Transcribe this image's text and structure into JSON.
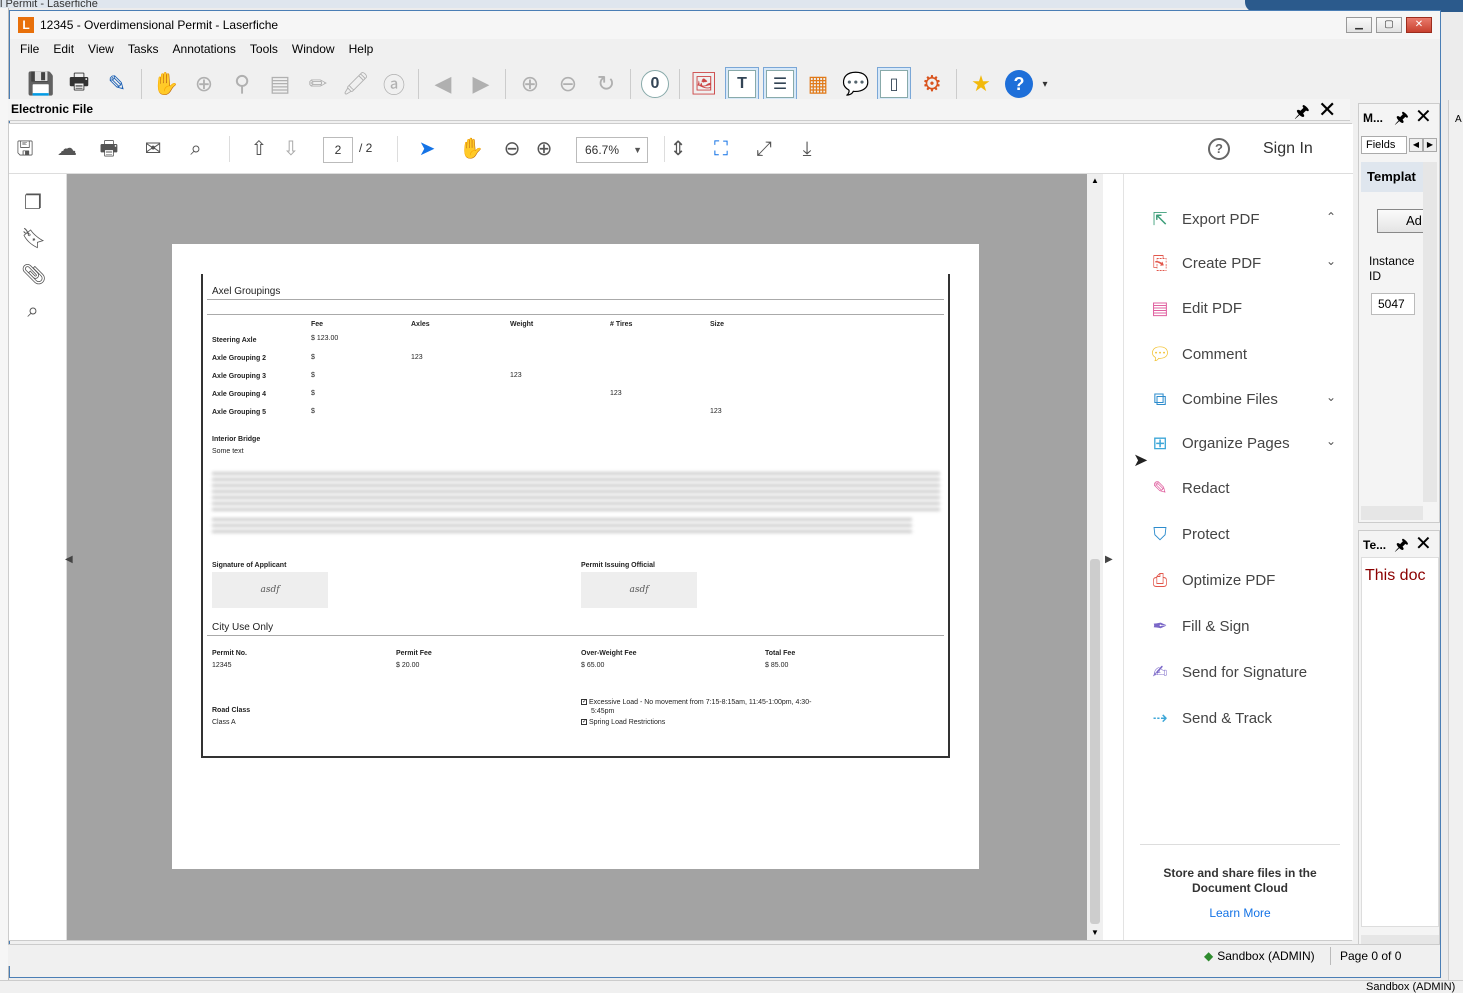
{
  "bg": {
    "title_fragment": "l Permit - Laserfiche",
    "right_fragment": "A",
    "bottom_fragment": "Sandbox (ADMIN)"
  },
  "window": {
    "app_logo": "L",
    "title": "12345 - Overdimensional Permit - Laserfiche",
    "min": "▁",
    "max": "▢",
    "close": "✕"
  },
  "menu": [
    "File",
    "Edit",
    "View",
    "Tasks",
    "Annotations",
    "Tools",
    "Window",
    "Help"
  ],
  "pane": {
    "title": "Electronic File",
    "pin": "🖈",
    "close": "✕"
  },
  "acrobat": {
    "page_current": "2",
    "page_total": "/ 2",
    "zoom": "66.7%",
    "help": "?",
    "sign_in": "Sign In"
  },
  "document": {
    "section1": "Axel Groupings",
    "columns": [
      "Fee",
      "Axles",
      "Weight",
      "# Tires",
      "Size"
    ],
    "rows": [
      {
        "label": "Steering Axle",
        "fee": "$ 123.00",
        "axles": "",
        "weight": "",
        "tires": "",
        "size": ""
      },
      {
        "label": "Axle Grouping 2",
        "fee": "$",
        "axles": "123",
        "weight": "",
        "tires": "",
        "size": ""
      },
      {
        "label": "Axle Grouping 3",
        "fee": "$",
        "axles": "",
        "weight": "123",
        "tires": "",
        "size": ""
      },
      {
        "label": "Axle Grouping 4",
        "fee": "$",
        "axles": "",
        "weight": "",
        "tires": "123",
        "size": ""
      },
      {
        "label": "Axle Grouping 5",
        "fee": "$",
        "axles": "",
        "weight": "",
        "tires": "",
        "size": "123"
      }
    ],
    "interior_bridge_label": "Interior Bridge",
    "interior_bridge_value": "Some text",
    "sig_applicant_label": "Signature of Applicant",
    "sig_applicant_value": "asdf",
    "sig_official_label": "Permit Issuing Official",
    "sig_official_value": "asdf",
    "section2": "City Use Only",
    "permit_no_label": "Permit No.",
    "permit_no_value": "12345",
    "permit_fee_label": "Permit Fee",
    "permit_fee_value": "$ 20.00",
    "overweight_fee_label": "Over-Weight Fee",
    "overweight_fee_value": "$ 65.00",
    "total_fee_label": "Total Fee",
    "total_fee_value": "$ 85.00",
    "road_class_label": "Road Class",
    "road_class_value": "Class A",
    "check1_line1": "Excessive Load - No movement from 7:15-8:15am, 11:45-1:00pm, 4:30-",
    "check1_line2": "5:45pm",
    "check2": "Spring Load Restrictions",
    "check_mark": "✓"
  },
  "tools": [
    {
      "label": "Export PDF",
      "chev": "⌃",
      "color": "#3d9e7a"
    },
    {
      "label": "Create PDF",
      "chev": "⌄",
      "color": "#e2574c"
    },
    {
      "label": "Edit PDF",
      "chev": "",
      "color": "#e061a0"
    },
    {
      "label": "Comment",
      "chev": "",
      "color": "#f2c12e"
    },
    {
      "label": "Combine Files",
      "chev": "⌄",
      "color": "#2d8ccd"
    },
    {
      "label": "Organize Pages",
      "chev": "⌄",
      "color": "#3ea7d8"
    },
    {
      "label": "Redact",
      "chev": "",
      "color": "#e061a0"
    },
    {
      "label": "Protect",
      "chev": "",
      "color": "#2d8ccd"
    },
    {
      "label": "Optimize PDF",
      "chev": "",
      "color": "#e2574c"
    },
    {
      "label": "Fill & Sign",
      "chev": "",
      "color": "#7b68c8"
    },
    {
      "label": "Send for Signature",
      "chev": "",
      "color": "#7b68c8"
    },
    {
      "label": "Send & Track",
      "chev": "",
      "color": "#3ea7d8"
    }
  ],
  "cloud": {
    "text": "Store and share files in the Document Cloud",
    "link": "Learn More"
  },
  "metadata_panel": {
    "title": "M...",
    "tab": "Fields",
    "template": "Templat",
    "add_button": "Ad",
    "instance_label": "Instance ID",
    "instance_value": "5047"
  },
  "text_panel": {
    "title": "Te...",
    "content": "This doc"
  },
  "status": {
    "repository": "Sandbox (ADMIN)",
    "page": "Page 0 of 0"
  }
}
